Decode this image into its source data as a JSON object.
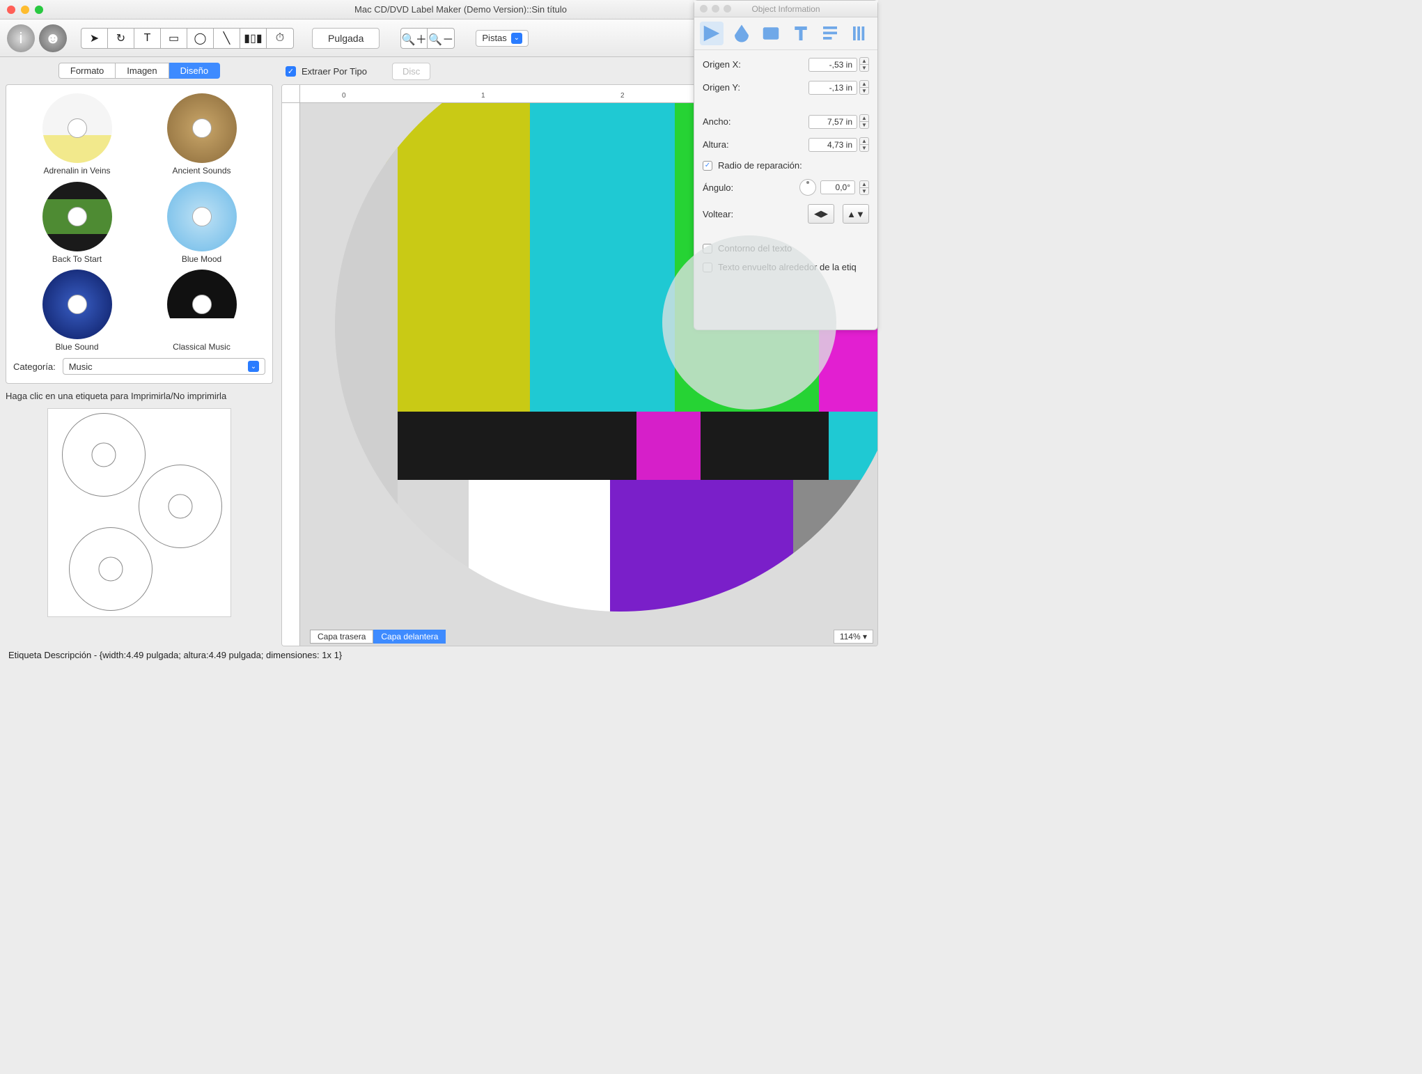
{
  "window": {
    "title": "Mac CD/DVD Label Maker (Demo Version)::Sin título"
  },
  "toolbar": {
    "unit_button": "Pulgada",
    "dropdown_label": "Pistas"
  },
  "sidebar": {
    "tabs": {
      "format": "Formato",
      "image": "Imagen",
      "design": "Diseño"
    },
    "thumbs": [
      {
        "label": "Adrenalin in Veins"
      },
      {
        "label": "Ancient Sounds"
      },
      {
        "label": "Back To Start"
      },
      {
        "label": "Blue Mood"
      },
      {
        "label": "Blue Sound"
      },
      {
        "label": "Classical Music"
      }
    ],
    "category_label": "Categoría:",
    "category_value": "Music",
    "hint": "Haga clic en una etiqueta para Imprimirla/No imprimirla"
  },
  "canvas": {
    "extract_label": "Extraer Por Tipo",
    "disc_button": "Disc",
    "ruler_marks": [
      "0",
      "1",
      "2"
    ],
    "layer_back": "Capa trasera",
    "layer_front": "Capa delantera",
    "zoom": "114%"
  },
  "inspector": {
    "title": "Object Information",
    "origin_x_label": "Origen X:",
    "origin_x_value": "-,53 in",
    "origin_y_label": "Origen Y:",
    "origin_y_value": "-,13 in",
    "width_label": "Ancho:",
    "width_value": "7,57 in",
    "height_label": "Altura:",
    "height_value": "4,73 in",
    "repair_radius": "Radio de reparación:",
    "angle_label": "Ángulo:",
    "angle_value": "0,0°",
    "flip_label": "Voltear:",
    "text_outline": "Contorno del texto",
    "text_wrap": "Texto envuelto alrededor de la etiq"
  },
  "status": "Etiqueta Descripción - {width:4.49 pulgada; altura:4.49 pulgada; dimensiones: 1x 1}"
}
